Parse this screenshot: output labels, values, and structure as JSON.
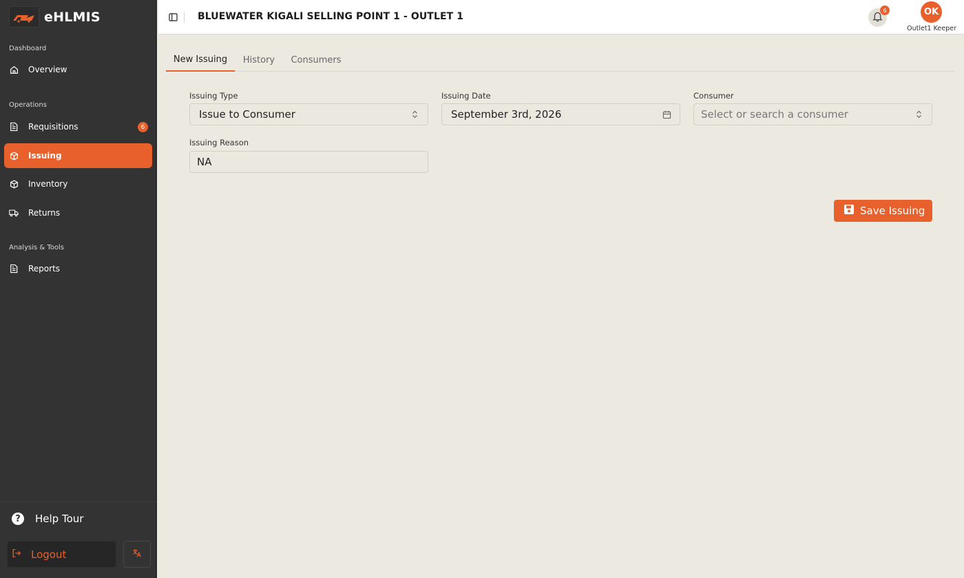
{
  "brand": {
    "name": "eHLMIS",
    "logo_icon": "truck-logo-icon"
  },
  "sidebar": {
    "sections": [
      {
        "label": "Dashboard"
      },
      {
        "label": "Operations"
      },
      {
        "label": "Analysis & Tools"
      }
    ],
    "items": [
      {
        "label": "Overview",
        "icon": "home-icon"
      },
      {
        "label": "Requisitions",
        "icon": "document-icon",
        "badge": "6"
      },
      {
        "label": "Issuing",
        "icon": "box-icon",
        "active": true
      },
      {
        "label": "Inventory",
        "icon": "box-icon"
      },
      {
        "label": "Returns",
        "icon": "truck-icon"
      },
      {
        "label": "Reports",
        "icon": "document-icon"
      }
    ],
    "help_label": "Help Tour",
    "logout_label": "Logout"
  },
  "topbar": {
    "title": "BLUEWATER KIGALI SELLING POINT 1 - OUTLET 1",
    "notification_count": "6",
    "avatar_initials": "OK",
    "user_name": "Outlet1 Keeper"
  },
  "tabs": [
    {
      "label": "New Issuing",
      "active": true
    },
    {
      "label": "History"
    },
    {
      "label": "Consumers"
    }
  ],
  "form": {
    "issuing_type": {
      "label": "Issuing Type",
      "value": "Issue to Consumer"
    },
    "issuing_date": {
      "label": "Issuing Date",
      "value": "September 3rd, 2026"
    },
    "consumer": {
      "label": "Consumer",
      "placeholder": "Select or search a consumer"
    },
    "issuing_reason": {
      "label": "Issuing Reason",
      "value": "NA"
    },
    "save_label": "Save Issuing"
  },
  "colors": {
    "accent": "#e8612c",
    "sidebar": "#333333",
    "background": "#ece9e1"
  }
}
